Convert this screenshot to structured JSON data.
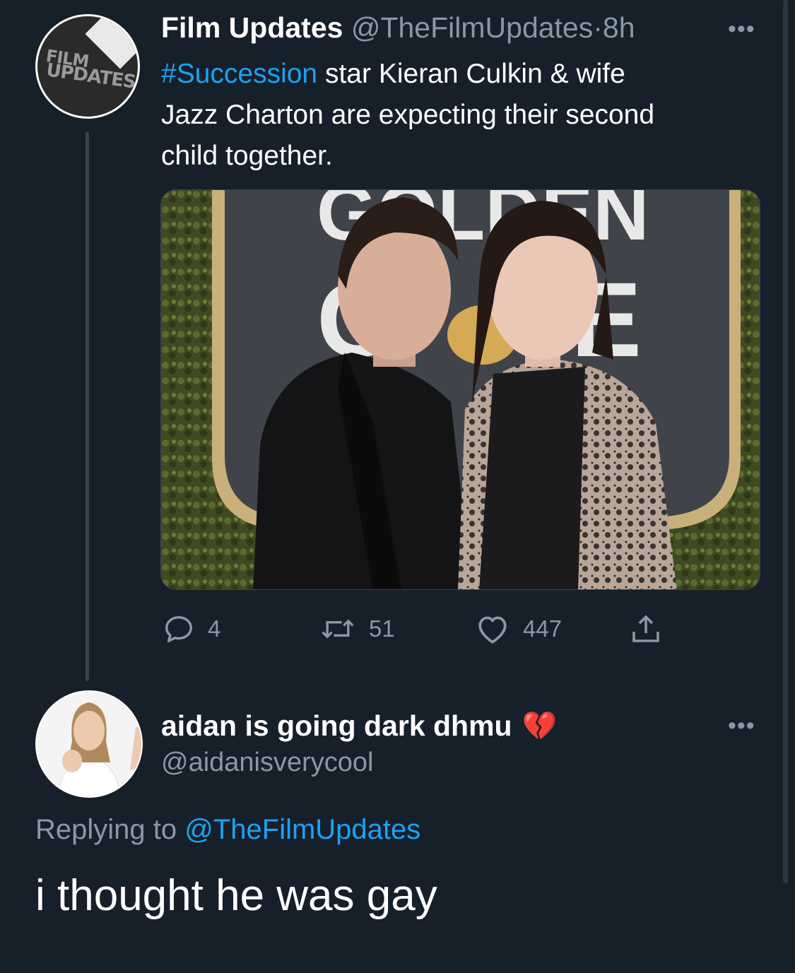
{
  "tweet": {
    "author_name": "Film Updates",
    "author_handle": "@TheFilmUpdates",
    "separator": "·",
    "time": "8h",
    "more_icon": "more-horizontal-icon",
    "avatar_text_line1": "FILM",
    "avatar_text_line2": "UPDATES",
    "hashtag": "#Succession",
    "text_line1_rest": " star Kieran Culkin & wife",
    "text_line2": "Jazz Charton are expecting their second",
    "text_line3": "child together.",
    "photo_sign_top": "GOLDEN",
    "actions": {
      "reply_count": "4",
      "retweet_count": "51",
      "like_count": "447"
    }
  },
  "reply": {
    "author_name": "aidan is going dark dhmu",
    "author_emoji": "💔",
    "author_handle": "@aidanisverycool",
    "replying_prefix": "Replying to ",
    "replying_to": "@TheFilmUpdates",
    "text": "i thought he was gay"
  },
  "colors": {
    "background": "#15202b",
    "link": "#1da1f2",
    "muted": "#8899a6"
  }
}
